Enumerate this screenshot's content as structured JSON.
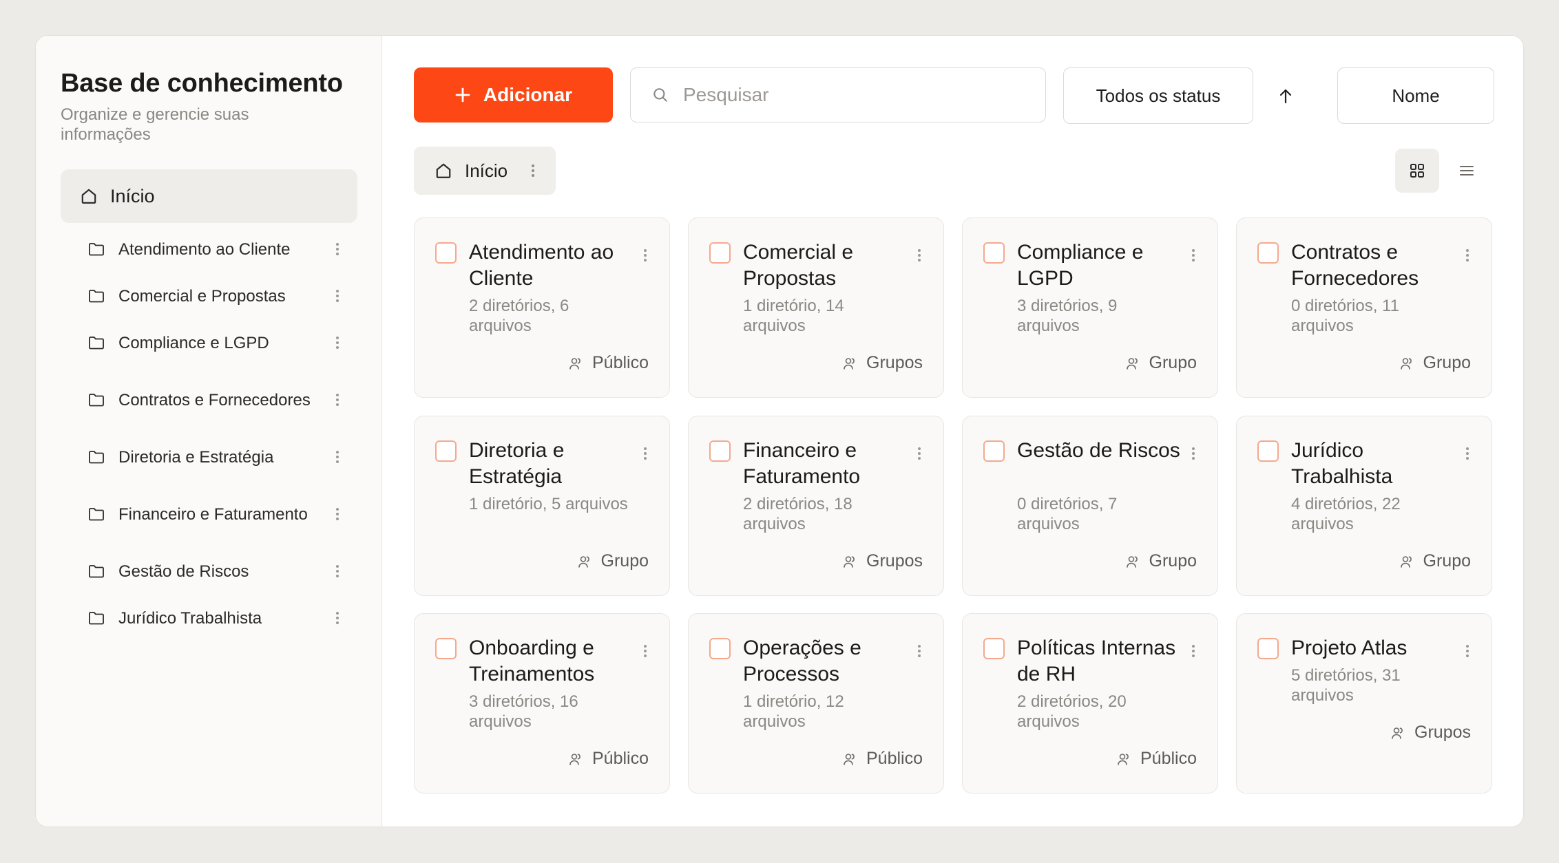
{
  "sidebar": {
    "title": "Base de conhecimento",
    "subtitle": "Organize e gerencie suas informações",
    "home_label": "Início",
    "items": [
      {
        "label": "Atendimento ao Cliente"
      },
      {
        "label": "Comercial e Propostas"
      },
      {
        "label": "Compliance e LGPD"
      },
      {
        "label": "Contratos e Fornecedores"
      },
      {
        "label": "Diretoria e Estratégia"
      },
      {
        "label": "Financeiro e Faturamento"
      },
      {
        "label": "Gestão de Riscos"
      },
      {
        "label": "Jurídico Trabalhista"
      }
    ]
  },
  "toolbar": {
    "add_label": "Adicionar",
    "search_placeholder": "Pesquisar",
    "search_value": "",
    "status_filter": "Todos os status",
    "sort_direction_icon": "arrow-up-icon",
    "sort_field": "Nome",
    "active_view": "grid"
  },
  "breadcrumb": {
    "label": "Início"
  },
  "cards": [
    {
      "title": "Atendimento ao Cliente",
      "meta": "2 diretórios, 6 arquivos",
      "access": "Público"
    },
    {
      "title": "Comercial e Propostas",
      "meta": "1 diretório, 14 arquivos",
      "access": "Grupos"
    },
    {
      "title": "Compliance e LGPD",
      "meta": "3 diretórios, 9 arquivos",
      "access": "Grupo"
    },
    {
      "title": "Contratos e Fornecedores",
      "meta": "0 diretórios, 11 arquivos",
      "access": "Grupo"
    },
    {
      "title": "Diretoria e Estratégia",
      "meta": "1 diretório, 5 arquivos",
      "access": "Grupo"
    },
    {
      "title": "Financeiro e Faturamento",
      "meta": "2 diretórios, 18 arquivos",
      "access": "Grupos"
    },
    {
      "title": "Gestão de Riscos",
      "meta": "0 diretórios, 7 arquivos",
      "access": "Grupo"
    },
    {
      "title": "Jurídico Trabalhista",
      "meta": "4 diretórios, 22 arquivos",
      "access": "Grupo"
    },
    {
      "title": "Onboarding e Treinamentos",
      "meta": "3 diretórios, 16 arquivos",
      "access": "Público"
    },
    {
      "title": "Operações e Processos",
      "meta": "1 diretório, 12 arquivos",
      "access": "Público"
    },
    {
      "title": "Políticas Internas de RH",
      "meta": "2 diretórios, 20 arquivos",
      "access": "Público"
    },
    {
      "title": "Projeto Atlas",
      "meta": "5 diretórios, 31 arquivos",
      "access": "Grupos"
    }
  ],
  "colors": {
    "accent": "#fd4715",
    "checkbox_border": "#f4a98d",
    "background": "#ecebe8",
    "card_background": "#faf9f8"
  }
}
